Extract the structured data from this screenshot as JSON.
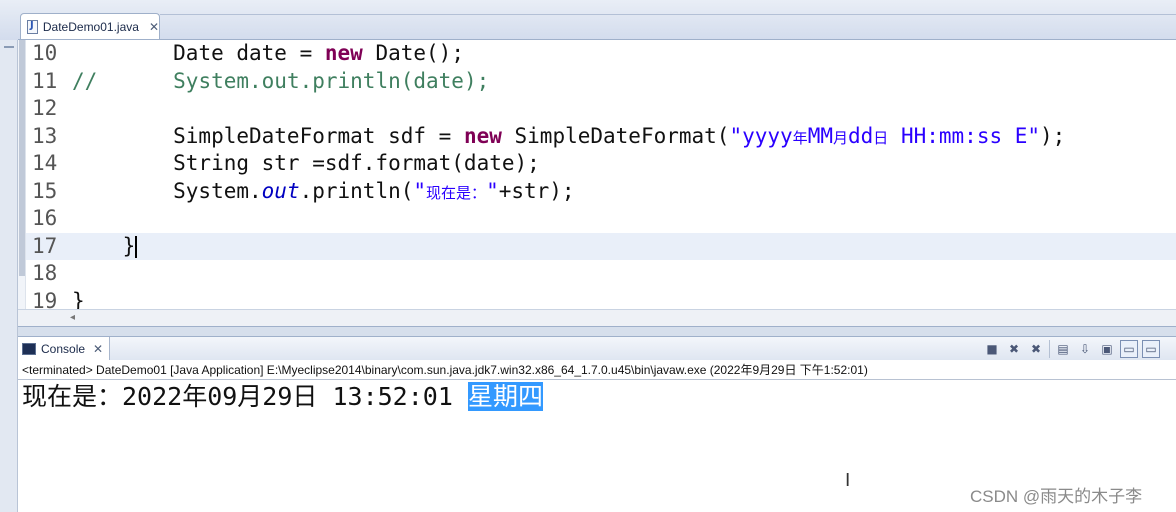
{
  "editor_tab": {
    "label": "DateDemo01.java",
    "icon": "java-file-icon",
    "close_glyph": "✕"
  },
  "code_lines": [
    {
      "number": "10",
      "tokens": [
        {
          "t": "        "
        },
        {
          "t": "Date date = "
        },
        {
          "t": "new",
          "c": "kw"
        },
        {
          "t": " Date();"
        }
      ]
    },
    {
      "number": "11",
      "tokens": [
        {
          "t": "//",
          "c": "cm"
        },
        {
          "t": "      System.out.println(date);",
          "c": "cm"
        }
      ]
    },
    {
      "number": "12",
      "tokens": []
    },
    {
      "number": "13",
      "tokens": [
        {
          "t": "        SimpleDateFormat sdf = "
        },
        {
          "t": "new",
          "c": "kw"
        },
        {
          "t": " SimpleDateFormat("
        },
        {
          "t": "\"yyyy",
          "c": "str"
        },
        {
          "t": "年",
          "c": "str cjk"
        },
        {
          "t": "MM",
          "c": "str"
        },
        {
          "t": "月",
          "c": "str cjk"
        },
        {
          "t": "dd",
          "c": "str"
        },
        {
          "t": "日",
          "c": "str cjk"
        },
        {
          "t": " HH:mm:ss E\"",
          "c": "str"
        },
        {
          "t": ");"
        }
      ]
    },
    {
      "number": "14",
      "tokens": [
        {
          "t": "        String str =sdf.format(date);"
        }
      ]
    },
    {
      "number": "15",
      "tokens": [
        {
          "t": "        System."
        },
        {
          "t": "out",
          "c": "field"
        },
        {
          "t": ".println("
        },
        {
          "t": "\"",
          "c": "str"
        },
        {
          "t": "现在是：",
          "c": "str cjk"
        },
        {
          "t": "\"",
          "c": "str"
        },
        {
          "t": "+str);"
        }
      ]
    },
    {
      "number": "16",
      "tokens": []
    },
    {
      "number": "17",
      "tokens": [
        {
          "t": "    }"
        },
        {
          "caret": true
        }
      ],
      "current": true
    },
    {
      "number": "18",
      "tokens": []
    },
    {
      "number": "19",
      "tokens": [
        {
          "t": "}"
        }
      ]
    }
  ],
  "console": {
    "tab_label": "Console",
    "tab_icon": "console-icon",
    "close_glyph": "✕",
    "launch_info": "<terminated> DateDemo01 [Java Application] E:\\Myeclipse2014\\binary\\com.sun.java.jdk7.win32.x86_64_1.7.0.u45\\bin\\javaw.exe (2022年9月29日 下午1:52:01)",
    "output_plain": "现在是：2022年09月29日 13:52:01 ",
    "output_selected": "星期四",
    "toolbar": [
      {
        "name": "terminate-button",
        "glyph": "■"
      },
      {
        "name": "remove-launch-button",
        "glyph": "✖"
      },
      {
        "name": "remove-all-terminated-button",
        "glyph": "✖"
      },
      {
        "name": "clear-console-button",
        "glyph": "▤"
      },
      {
        "name": "scroll-lock-button",
        "glyph": "⇩"
      },
      {
        "name": "pin-console-button",
        "glyph": "▣"
      },
      {
        "name": "display-selected-console-button",
        "glyph": "▭"
      },
      {
        "name": "open-console-button",
        "glyph": "▭"
      }
    ]
  },
  "watermark": "CSDN @雨天的木子李"
}
